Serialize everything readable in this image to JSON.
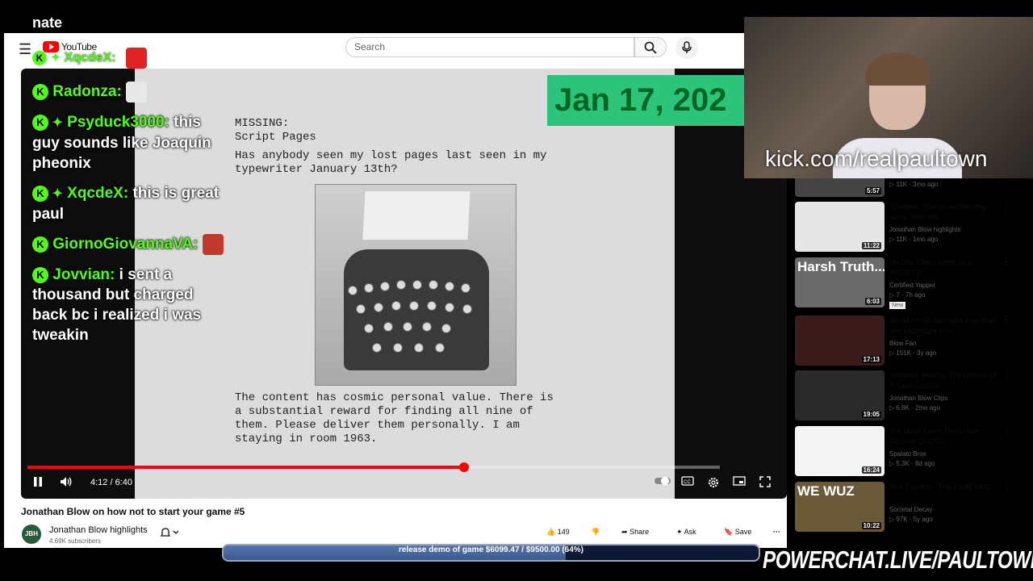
{
  "overlay": {
    "top_user": "nate",
    "kick_url": "kick.com/realpaultown",
    "powerchat": "POWERCHAT.LIVE/PAULTOWN",
    "goal": {
      "text": "release demo of game $6099.47 / $9500.00 (64%)",
      "fraction": 0.64
    },
    "logo_chatter": "XqcdeX:"
  },
  "youtube": {
    "logo_text": "YouTube",
    "search": {
      "placeholder": "Search"
    }
  },
  "chat": [
    {
      "badge": "K",
      "star": false,
      "user": "Radonza:",
      "text": ""
    },
    {
      "badge": "K",
      "star": true,
      "user": "Psyduck3000:",
      "text": "this guy sounds like Joaquin pheonix"
    },
    {
      "badge": "K",
      "star": true,
      "user": "XqcdeX:",
      "text": "this is great paul"
    },
    {
      "badge": "K",
      "star": false,
      "user": "GiornoGiovannaVA:",
      "text": ""
    },
    {
      "badge": "K",
      "star": false,
      "user": "Jovvian:",
      "text": "i sent a thousand but charged back bc i realized i was tweakin"
    }
  ],
  "video": {
    "date_overlay": "Jan 17, 202",
    "doc_header": "MISSING:\nScript Pages",
    "doc_top": "Has anybody seen my lost pages last seen in my\ntypewriter January 13th?",
    "doc_bottom": "The content has cosmic personal value. There is\na substantial reward for finding all nine of\nthem. Please deliver them personally. I am\nstaying in room 1963.",
    "time": "4:12 / 6:40",
    "progress_fraction": 0.63,
    "title": "Jonathan Blow on how not to start your game #5",
    "channel": "Jonathan Blow highlights",
    "channel_initials": "JBH",
    "subscribers": "4.69K subscribers",
    "likes": "149",
    "share": "Share",
    "ask": "Ask",
    "save": "Save"
  },
  "sidebar": [
    {
      "title": "",
      "channel": "",
      "meta": "▷ 11K · 3mo ago",
      "duration": "5:57",
      "thumb_text": "",
      "new": ""
    },
    {
      "title": "Jonathan Blow on architecting game networks",
      "channel": "Jonathan Blow highlights",
      "meta": "▷ 11K · 1mo ago",
      "duration": "11:22",
      "thumb_text": "",
      "new": ""
    },
    {
      "title": "No One Cares about your ANXIETY!",
      "channel": "Certified Yapper",
      "meta": "▷ 7 · 7h ago",
      "duration": "6:03",
      "thumb_text": "Harsh Truth...",
      "new": "New"
    },
    {
      "title": "Social media damages your brain and sabotages your ...",
      "channel": "Blow Fan",
      "meta": "▷ 151K · 3y ago",
      "duration": "17:13",
      "thumb_text": "",
      "new": ""
    },
    {
      "title": "Jonathan Blow on The Decline of Art and Cultural ...",
      "channel": "Jonathan Blow Clips",
      "meta": "▷ 6.8K · 2mo ago",
      "duration": "19:05",
      "thumb_text": "",
      "new": ""
    },
    {
      "title": "Too Many Game Devs Have Become CUCKS!",
      "channel": "Spalato Bros",
      "meta": "▷ 5.3K · 8d ago",
      "duration": "16:24",
      "thumb_text": "",
      "new": ""
    },
    {
      "title": "Nick Fuentes - THEY EAT MUD",
      "channel": "Societal Decay",
      "meta": "▷ 97K · 5y ago",
      "duration": "10:22",
      "thumb_text": "WE WUZ",
      "new": ""
    }
  ]
}
